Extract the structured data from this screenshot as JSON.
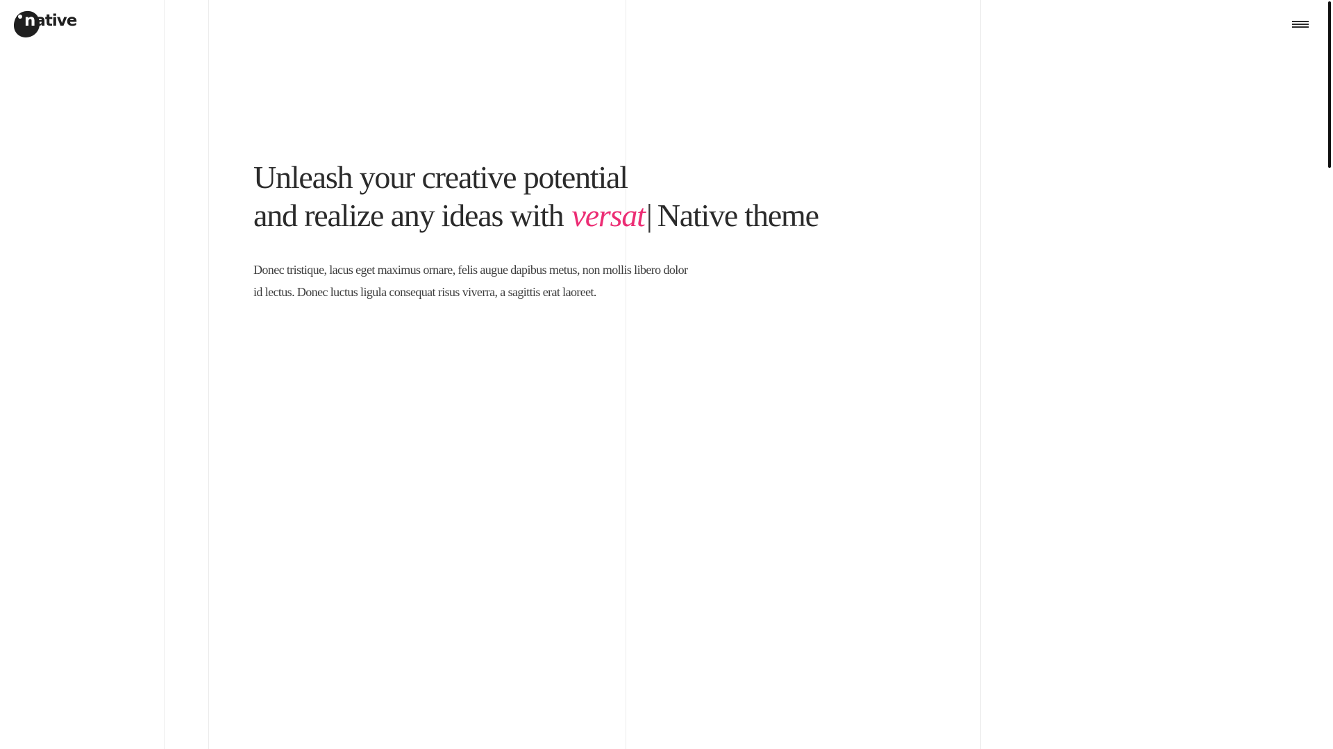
{
  "brand": {
    "logo_text_first": "n",
    "logo_text_rest": "ative",
    "accent_color": "#ec2d74"
  },
  "header": {
    "menu_icon": "hamburger-menu-icon"
  },
  "hero": {
    "title_line1": "Unleash your creative potential",
    "title_line2_start": "and realize any ideas with",
    "title_typed_word": "versat",
    "title_caret": "|",
    "title_line2_end": "Native theme",
    "paragraph": "Donec tristique, lacus eget maximus ornare, felis augue dapibus metus, non mollis libero dolor id lectus. Donec luctus ligula consequat risus viverra, a sagittis erat laoreet."
  }
}
